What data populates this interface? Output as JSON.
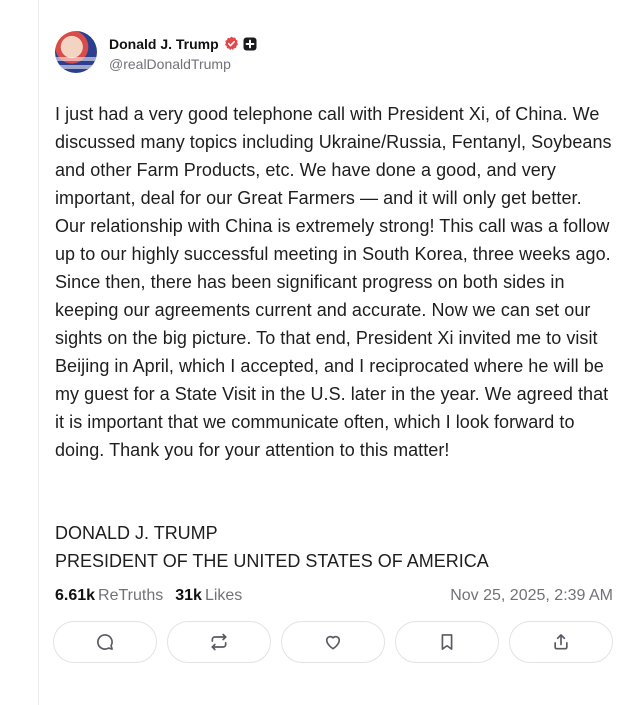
{
  "author": {
    "display_name": "Donald J. Trump",
    "handle": "@realDonaldTrump",
    "verified_icon": "verified-badge-icon",
    "extra_badge_icon": "plus-badge-icon"
  },
  "post": {
    "body": "I just had a very good telephone call with President Xi, of China. We discussed many topics including Ukraine/Russia, Fentanyl, Soybeans and other Farm Products, etc. We have done a good, and very important, deal for our Great Farmers — and it will only get better. Our relationship with China is extremely strong! This call was a follow up to our highly successful meeting in South Korea, three weeks ago. Since then, there has been significant progress on both sides in keeping our agreements current and accurate. Now we can set our sights on the big picture. To that end, President Xi invited me to visit Beijing in April, which I accepted, and I reciprocated where he will be my guest for a State Visit in the U.S. later in the year. We agreed that it is important that we communicate often, which I look forward to doing. Thank you for your attention to this matter!",
    "signature_name": "DONALD J. TRUMP",
    "signature_title": "PRESIDENT OF THE UNITED STATES OF AMERICA"
  },
  "stats": {
    "retruths_count": "6.61k",
    "retruths_label": "ReTruths",
    "likes_count": "31k",
    "likes_label": "Likes",
    "timestamp": "Nov 25, 2025, 2:39 AM"
  },
  "actions": [
    {
      "icon": "reply-icon"
    },
    {
      "icon": "retruth-icon"
    },
    {
      "icon": "like-heart-icon"
    },
    {
      "icon": "bookmark-icon"
    },
    {
      "icon": "share-icon"
    }
  ],
  "colors": {
    "verified": "#e2474b",
    "muted_text": "#717178",
    "border": "#e3e3e6",
    "icon": "#5a5a62"
  }
}
